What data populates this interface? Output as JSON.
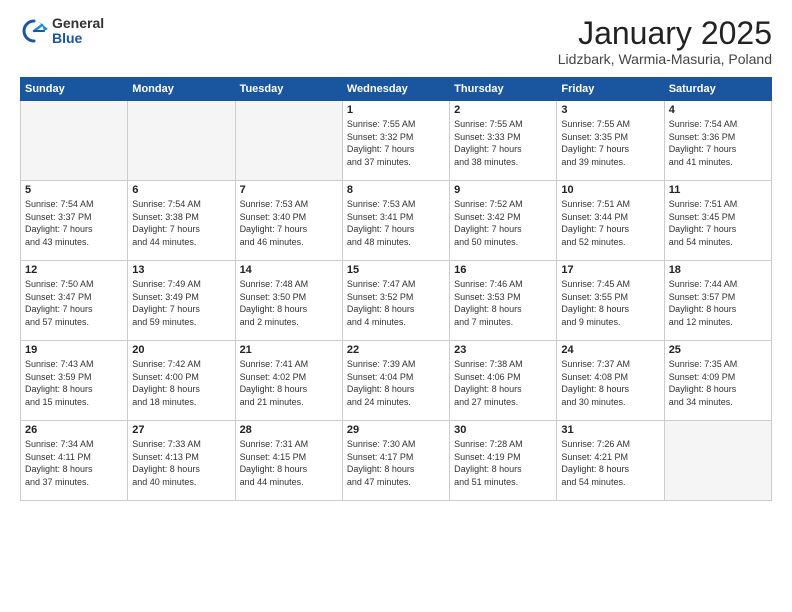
{
  "logo": {
    "general": "General",
    "blue": "Blue"
  },
  "header": {
    "title": "January 2025",
    "subtitle": "Lidzbark, Warmia-Masuria, Poland"
  },
  "weekdays": [
    "Sunday",
    "Monday",
    "Tuesday",
    "Wednesday",
    "Thursday",
    "Friday",
    "Saturday"
  ],
  "weeks": [
    [
      {
        "day": "",
        "info": ""
      },
      {
        "day": "",
        "info": ""
      },
      {
        "day": "",
        "info": ""
      },
      {
        "day": "1",
        "info": "Sunrise: 7:55 AM\nSunset: 3:32 PM\nDaylight: 7 hours\nand 37 minutes."
      },
      {
        "day": "2",
        "info": "Sunrise: 7:55 AM\nSunset: 3:33 PM\nDaylight: 7 hours\nand 38 minutes."
      },
      {
        "day": "3",
        "info": "Sunrise: 7:55 AM\nSunset: 3:35 PM\nDaylight: 7 hours\nand 39 minutes."
      },
      {
        "day": "4",
        "info": "Sunrise: 7:54 AM\nSunset: 3:36 PM\nDaylight: 7 hours\nand 41 minutes."
      }
    ],
    [
      {
        "day": "5",
        "info": "Sunrise: 7:54 AM\nSunset: 3:37 PM\nDaylight: 7 hours\nand 43 minutes."
      },
      {
        "day": "6",
        "info": "Sunrise: 7:54 AM\nSunset: 3:38 PM\nDaylight: 7 hours\nand 44 minutes."
      },
      {
        "day": "7",
        "info": "Sunrise: 7:53 AM\nSunset: 3:40 PM\nDaylight: 7 hours\nand 46 minutes."
      },
      {
        "day": "8",
        "info": "Sunrise: 7:53 AM\nSunset: 3:41 PM\nDaylight: 7 hours\nand 48 minutes."
      },
      {
        "day": "9",
        "info": "Sunrise: 7:52 AM\nSunset: 3:42 PM\nDaylight: 7 hours\nand 50 minutes."
      },
      {
        "day": "10",
        "info": "Sunrise: 7:51 AM\nSunset: 3:44 PM\nDaylight: 7 hours\nand 52 minutes."
      },
      {
        "day": "11",
        "info": "Sunrise: 7:51 AM\nSunset: 3:45 PM\nDaylight: 7 hours\nand 54 minutes."
      }
    ],
    [
      {
        "day": "12",
        "info": "Sunrise: 7:50 AM\nSunset: 3:47 PM\nDaylight: 7 hours\nand 57 minutes."
      },
      {
        "day": "13",
        "info": "Sunrise: 7:49 AM\nSunset: 3:49 PM\nDaylight: 7 hours\nand 59 minutes."
      },
      {
        "day": "14",
        "info": "Sunrise: 7:48 AM\nSunset: 3:50 PM\nDaylight: 8 hours\nand 2 minutes."
      },
      {
        "day": "15",
        "info": "Sunrise: 7:47 AM\nSunset: 3:52 PM\nDaylight: 8 hours\nand 4 minutes."
      },
      {
        "day": "16",
        "info": "Sunrise: 7:46 AM\nSunset: 3:53 PM\nDaylight: 8 hours\nand 7 minutes."
      },
      {
        "day": "17",
        "info": "Sunrise: 7:45 AM\nSunset: 3:55 PM\nDaylight: 8 hours\nand 9 minutes."
      },
      {
        "day": "18",
        "info": "Sunrise: 7:44 AM\nSunset: 3:57 PM\nDaylight: 8 hours\nand 12 minutes."
      }
    ],
    [
      {
        "day": "19",
        "info": "Sunrise: 7:43 AM\nSunset: 3:59 PM\nDaylight: 8 hours\nand 15 minutes."
      },
      {
        "day": "20",
        "info": "Sunrise: 7:42 AM\nSunset: 4:00 PM\nDaylight: 8 hours\nand 18 minutes."
      },
      {
        "day": "21",
        "info": "Sunrise: 7:41 AM\nSunset: 4:02 PM\nDaylight: 8 hours\nand 21 minutes."
      },
      {
        "day": "22",
        "info": "Sunrise: 7:39 AM\nSunset: 4:04 PM\nDaylight: 8 hours\nand 24 minutes."
      },
      {
        "day": "23",
        "info": "Sunrise: 7:38 AM\nSunset: 4:06 PM\nDaylight: 8 hours\nand 27 minutes."
      },
      {
        "day": "24",
        "info": "Sunrise: 7:37 AM\nSunset: 4:08 PM\nDaylight: 8 hours\nand 30 minutes."
      },
      {
        "day": "25",
        "info": "Sunrise: 7:35 AM\nSunset: 4:09 PM\nDaylight: 8 hours\nand 34 minutes."
      }
    ],
    [
      {
        "day": "26",
        "info": "Sunrise: 7:34 AM\nSunset: 4:11 PM\nDaylight: 8 hours\nand 37 minutes."
      },
      {
        "day": "27",
        "info": "Sunrise: 7:33 AM\nSunset: 4:13 PM\nDaylight: 8 hours\nand 40 minutes."
      },
      {
        "day": "28",
        "info": "Sunrise: 7:31 AM\nSunset: 4:15 PM\nDaylight: 8 hours\nand 44 minutes."
      },
      {
        "day": "29",
        "info": "Sunrise: 7:30 AM\nSunset: 4:17 PM\nDaylight: 8 hours\nand 47 minutes."
      },
      {
        "day": "30",
        "info": "Sunrise: 7:28 AM\nSunset: 4:19 PM\nDaylight: 8 hours\nand 51 minutes."
      },
      {
        "day": "31",
        "info": "Sunrise: 7:26 AM\nSunset: 4:21 PM\nDaylight: 8 hours\nand 54 minutes."
      },
      {
        "day": "",
        "info": ""
      }
    ]
  ]
}
